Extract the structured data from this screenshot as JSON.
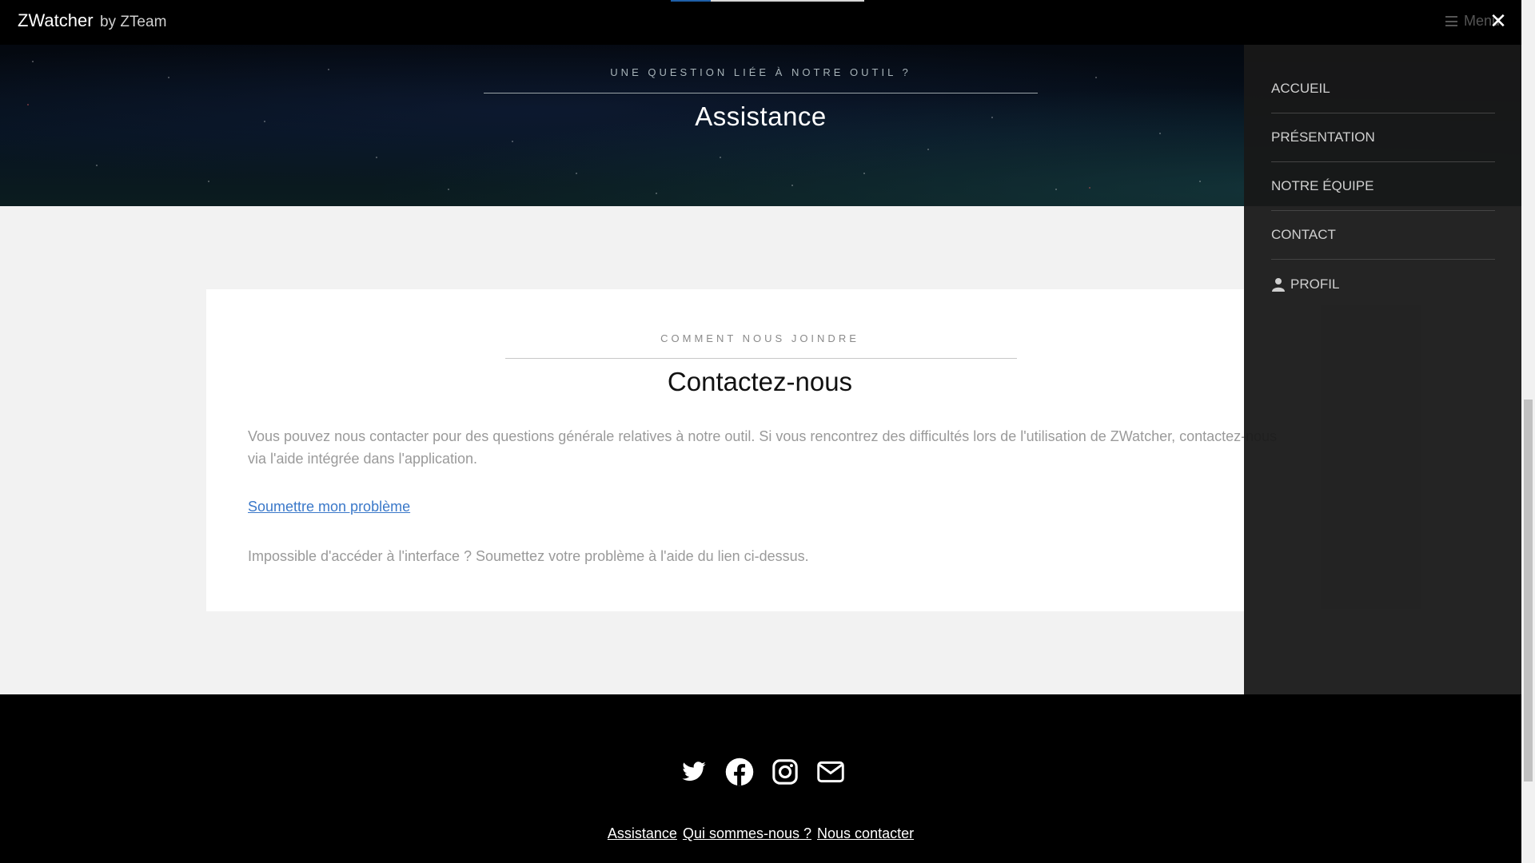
{
  "header": {
    "brand_name": "ZWatcher",
    "brand_by": "by ZTeam",
    "menu_label": "Menu",
    "menu_icon": "hamburger-icon",
    "close_icon": "close-icon",
    "close_glyph": "✕"
  },
  "hero": {
    "subtitle": "UNE QUESTION LIÉE À NOTRE OUTIL ?",
    "title": "Assistance"
  },
  "contact": {
    "subtitle": "COMMENT NOUS JOINDRE",
    "title": "Contactez-nous",
    "paragraph": "Vous pouvez nous contacter pour des questions générale relatives à notre outil. Si vous rencontrez des difficultés lors de l'utilisation de ZWatcher, contactez-nous via l'aide intégrée dans l'application.",
    "link_label": "Soumettre mon problème",
    "note": "Impossible d'accéder à l'interface ? Soumettez votre problème à l'aide du lien ci-dessus."
  },
  "side_menu": {
    "items": [
      {
        "label": "ACCUEIL"
      },
      {
        "label": "PRÉSENTATION"
      },
      {
        "label": "NOTRE ÉQUIPE"
      },
      {
        "label": "CONTACT"
      },
      {
        "label": "PROFIL",
        "icon": "user-icon"
      }
    ]
  },
  "footer": {
    "socials": [
      {
        "icon": "twitter-icon"
      },
      {
        "icon": "facebook-icon"
      },
      {
        "icon": "instagram-icon"
      },
      {
        "icon": "email-icon"
      }
    ],
    "links": [
      "Assistance",
      "Qui sommes-nous ?",
      "Nous contacter"
    ]
  },
  "colors": {
    "link": "#3a78c9",
    "main_bg": "#f2f2f2",
    "footer_bg": "#000000",
    "sidenav_bg": "#181818"
  }
}
